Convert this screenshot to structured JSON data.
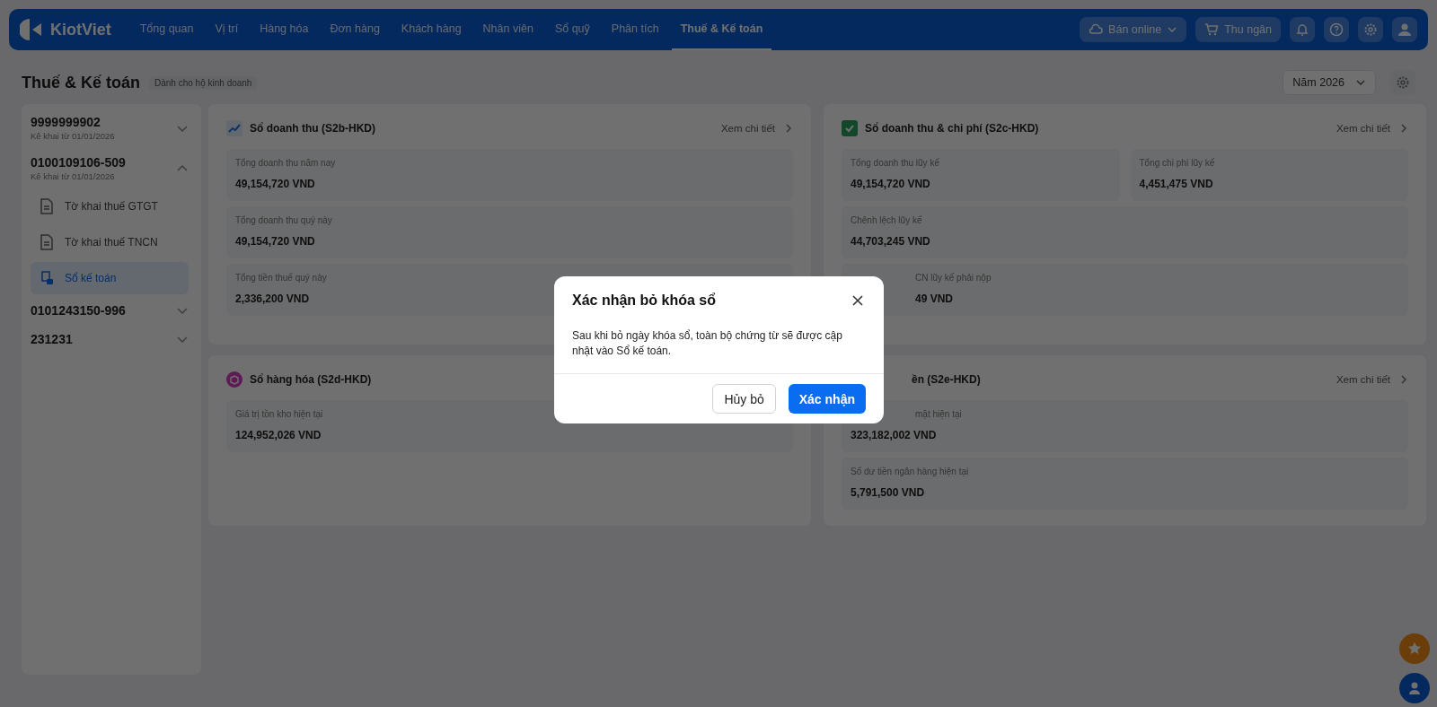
{
  "nav": {
    "brand": "KiotViet",
    "items": [
      {
        "label": "Tổng quan",
        "selected": false
      },
      {
        "label": "Vị trí",
        "selected": false
      },
      {
        "label": "Hàng hóa",
        "selected": false
      },
      {
        "label": "Đơn hàng",
        "selected": false
      },
      {
        "label": "Khách hàng",
        "selected": false
      },
      {
        "label": "Nhân viên",
        "selected": false
      },
      {
        "label": "Sổ quỹ",
        "selected": false
      },
      {
        "label": "Phân tích",
        "selected": false
      },
      {
        "label": "Thuế & Kế toán",
        "selected": true
      }
    ],
    "online_button": "Bán online",
    "cashier_button": "Thu ngân"
  },
  "page": {
    "title": "Thuế & Kế toán",
    "tag": "Dành cho hộ kinh doanh",
    "year_select": "Năm 2026"
  },
  "sidebar": [
    {
      "code": "9999999902",
      "subtitle": "Kê khai từ 01/01/2026",
      "expanded": false
    },
    {
      "code": "0100109106-509",
      "subtitle": "Kê khai từ 01/01/2026",
      "expanded": true,
      "children": [
        {
          "label": "Tờ khai thuế GTGT",
          "kind": "document",
          "selected": false
        },
        {
          "label": "Tờ khai thuế TNCN",
          "kind": "document",
          "selected": false
        },
        {
          "label": "Sổ kế toán",
          "kind": "ledger",
          "selected": true
        }
      ]
    },
    {
      "code": "0101243150-996",
      "expanded": false
    },
    {
      "code": "231231",
      "expanded": false
    }
  ],
  "cards": [
    {
      "title": "Sổ doanh thu (S2b-HKD)",
      "link": "Xem chi tiết",
      "rows": [
        [
          {
            "label": "Tổng doanh thu năm nay",
            "value": "49,154,720 VND"
          }
        ],
        [
          {
            "label": "Tổng doanh thu quý này",
            "value": "49,154,720 VND"
          }
        ],
        [
          {
            "label": "Tổng tiền thuế quý này",
            "value": "2,336,200 VND"
          }
        ]
      ]
    },
    {
      "title": "Sổ doanh thu & chi phí (S2c-HKD)",
      "link": "Xem chi tiết",
      "rows": [
        [
          {
            "label": "Tổng doanh thu lũy kế",
            "value": "49,154,720 VND"
          },
          {
            "label": "Tổng chi phí lũy kế",
            "value": "4,451,475 VND"
          }
        ],
        [
          {
            "label": "Chênh lệch lũy kế",
            "value": "44,703,245 VND"
          }
        ],
        [
          {
            "label": "CN lũy kế phải nộp",
            "value": "49 VND",
            "cut": true
          }
        ]
      ]
    },
    {
      "title": "Sổ hàng hóa (S2d-HKD)",
      "rows": [
        [
          {
            "label": "Giá trị tồn kho hiện tại",
            "value": "124,952,026 VND"
          }
        ]
      ]
    },
    {
      "title": "ền (S2e-HKD)",
      "cut": true,
      "link": "Xem chi tiết",
      "rows": [
        [
          {
            "label": "mặt hiện tại",
            "value": "323,182,002 VND",
            "cut": true
          }
        ],
        [
          {
            "label": "Số dư tiền ngân hàng hiện tại",
            "value": "5,791,500 VND"
          }
        ]
      ]
    }
  ],
  "dialog": {
    "title": "Xác nhận bỏ khóa sổ",
    "body": "Sau khi bỏ ngày khóa sổ, toàn bộ chứng từ sẽ được cập nhật vào Sổ kế toán.",
    "cancel": "Hủy bỏ",
    "confirm": "Xác nhận"
  }
}
